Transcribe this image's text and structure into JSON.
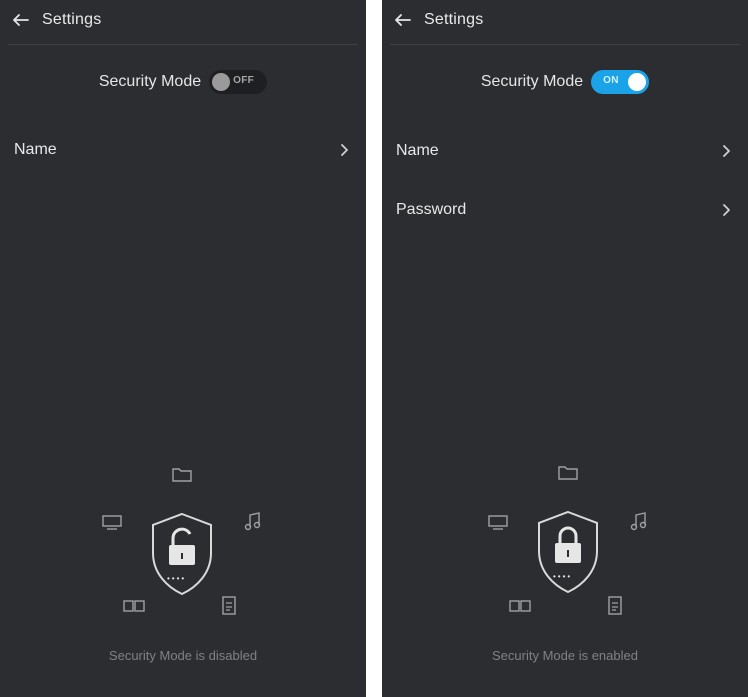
{
  "screens": {
    "left": {
      "header": {
        "title": "Settings",
        "back_icon": "arrow-left-icon"
      },
      "security_mode": {
        "label": "Security Mode",
        "toggle_state": "OFF",
        "enabled": false
      },
      "menu": [
        {
          "label": "Name",
          "icon": "chevron-right-icon"
        }
      ],
      "illustration": {
        "center_icon": "unlocked-shield-icon",
        "password_dots": "••••"
      },
      "status_text": "Security Mode is disabled"
    },
    "right": {
      "header": {
        "title": "Settings",
        "back_icon": "arrow-left-icon"
      },
      "security_mode": {
        "label": "Security Mode",
        "toggle_state": "ON",
        "enabled": true
      },
      "menu": [
        {
          "label": "Name",
          "icon": "chevron-right-icon"
        },
        {
          "label": "Password",
          "icon": "chevron-right-icon"
        }
      ],
      "illustration": {
        "center_icon": "locked-shield-icon",
        "password_dots": "••••"
      },
      "status_text": "Security Mode is enabled"
    }
  },
  "colors": {
    "background": "#2b2d31",
    "text": "#e6e6e6",
    "muted_text": "#7f8187",
    "toggle_on": "#1aa3e8",
    "toggle_off": "#1e1f22"
  }
}
